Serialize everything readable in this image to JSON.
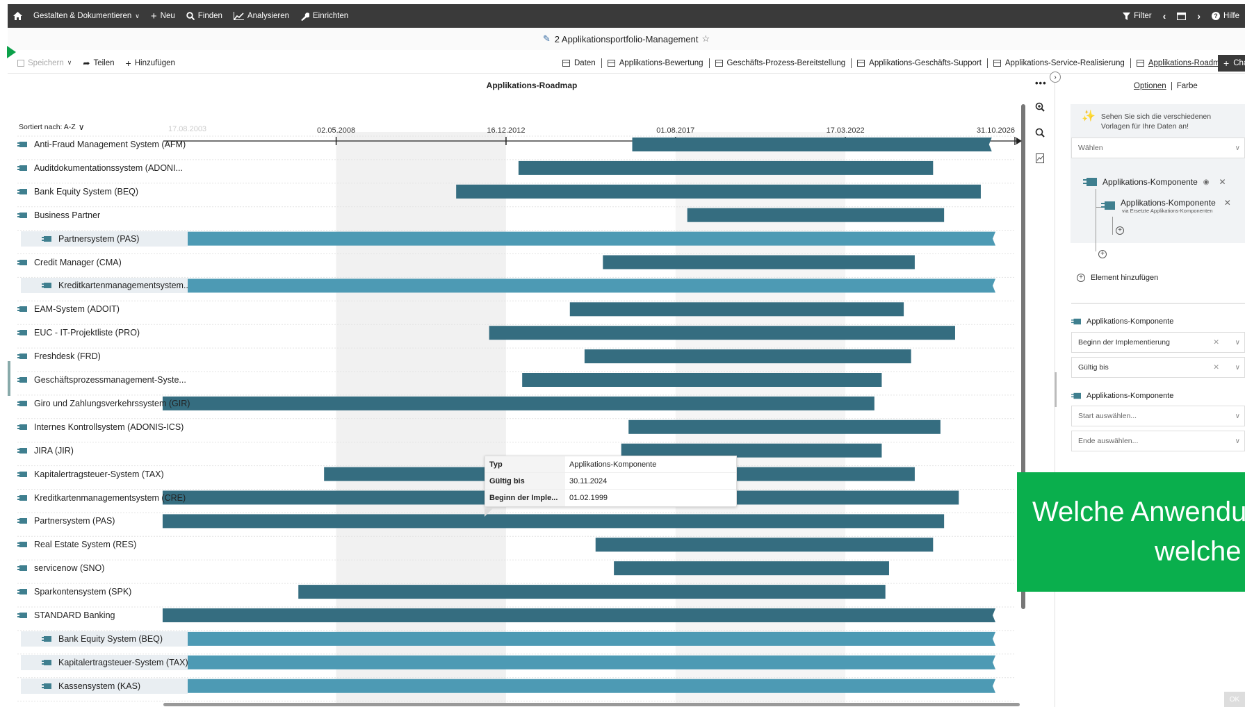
{
  "topnav": {
    "items": [
      {
        "label": "Gestalten & Dokumentieren",
        "icon": "chevron-down-icon"
      },
      {
        "label": "Neu",
        "icon": "plus-icon"
      },
      {
        "label": "Finden",
        "icon": "search-icon"
      },
      {
        "label": "Analysieren",
        "icon": "chart-line-icon"
      },
      {
        "label": "Einrichten",
        "icon": "wrench-icon"
      }
    ],
    "filter_label": "Filter",
    "help_label": "Hilfe"
  },
  "title": {
    "text": "2 Applikationsportfolio-Management",
    "star": "☆"
  },
  "toolbar": {
    "save_label": "Speichern",
    "share_label": "Teilen",
    "add_label": "Hinzufügen",
    "views": [
      {
        "label": "Daten",
        "icon": "table-icon",
        "active": false
      },
      {
        "label": "Applikations-Bewertung",
        "icon": "matrix-icon",
        "active": false
      },
      {
        "label": "Geschäfts-Prozess-Bereitstellung",
        "icon": "layout-icon",
        "active": false
      },
      {
        "label": "Applikations-Geschäfts-Support",
        "icon": "grid-icon",
        "active": false
      },
      {
        "label": "Applikations-Service-Realisierung",
        "icon": "grid-icon",
        "active": false
      },
      {
        "label": "Applikations-Roadmap",
        "icon": "roadmap-icon",
        "active": true
      }
    ],
    "chart_label": "Cha"
  },
  "chart": {
    "title": "Applikations-Roadmap",
    "more": "•••",
    "sort_label": "Sortiert nach: A-Z"
  },
  "chart_data": {
    "type": "gantt",
    "title": "Applikations-Roadmap",
    "axis": {
      "start_label_faded": "17.08.2003",
      "ticks": [
        "02.05.2008",
        "16.12.2012",
        "01.08.2017",
        "17.03.2022",
        "31.10.2026"
      ]
    },
    "rows": [
      {
        "label": "Anti-Fraud Management System (AFM)",
        "child": false,
        "start": 2016.4,
        "end": 2026.2
      },
      {
        "label": "Auditdokumentationssystem (ADONI...",
        "child": false,
        "start": 2013.3,
        "end": 2024.6
      },
      {
        "label": "Bank Equity System (BEQ)",
        "child": false,
        "start": 2011.6,
        "end": 2025.9
      },
      {
        "label": "Business Partner",
        "child": false,
        "start": 2017.9,
        "end": 2024.9
      },
      {
        "label": "Partnersystem (PAS)",
        "child": true,
        "start": 2003.6,
        "end": 2026.3
      },
      {
        "label": "Credit Manager (CMA)",
        "child": false,
        "start": 2015.6,
        "end": 2024.1
      },
      {
        "label": "Kreditkartenmanagementsystem...",
        "child": true,
        "start": 2003.6,
        "end": 2026.3
      },
      {
        "label": "EAM-System (ADOIT)",
        "child": false,
        "start": 2014.7,
        "end": 2023.8
      },
      {
        "label": "EUC - IT-Projektliste (PRO)",
        "child": false,
        "start": 2012.5,
        "end": 2025.2
      },
      {
        "label": "Freshdesk (FRD)",
        "child": false,
        "start": 2015.1,
        "end": 2024.0
      },
      {
        "label": "Geschäftsprozessmanagement-Syste...",
        "child": false,
        "start": 2013.4,
        "end": 2023.2
      },
      {
        "label": "Giro und Zahlungsverkehrssystem (GIR)",
        "child": false,
        "start": 2003.6,
        "end": 2023.0
      },
      {
        "label": "Internes Kontrollsystem (ADONIS-ICS)",
        "child": false,
        "start": 2016.3,
        "end": 2024.8
      },
      {
        "label": "JIRA (JIR)",
        "child": false,
        "start": 2016.1,
        "end": 2023.2
      },
      {
        "label": "Kapitalertragsteuer-System (TAX)",
        "child": false,
        "start": 2008.0,
        "end": 2024.1
      },
      {
        "label": "Kreditkartenmanagementsystem (CRE)",
        "child": false,
        "start": 2003.6,
        "end": 2025.3
      },
      {
        "label": "Partnersystem (PAS)",
        "child": false,
        "start": 2003.6,
        "end": 2024.9
      },
      {
        "label": "Real Estate System (RES)",
        "child": false,
        "start": 2015.4,
        "end": 2024.6
      },
      {
        "label": "servicenow (SNO)",
        "child": false,
        "start": 2015.9,
        "end": 2023.4
      },
      {
        "label": "Sparkontensystem (SPK)",
        "child": false,
        "start": 2007.3,
        "end": 2023.3
      },
      {
        "label": "STANDARD Banking",
        "child": false,
        "start": 2003.6,
        "end": 2026.3
      },
      {
        "label": "Bank Equity System (BEQ)",
        "child": true,
        "start": 2003.6,
        "end": 2026.3
      },
      {
        "label": "Kapitalertragsteuer-System (TAX)",
        "child": true,
        "start": 2003.6,
        "end": 2026.3
      },
      {
        "label": "Kassensystem (KAS)",
        "child": true,
        "start": 2003.6,
        "end": 2026.3
      }
    ]
  },
  "tooltip": {
    "rows": [
      {
        "key": "Typ",
        "value": "Applikations-Komponente"
      },
      {
        "key": "Gültig bis",
        "value": "30.11.2024"
      },
      {
        "key": "Beginn der Imple...",
        "value": "01.02.1999"
      }
    ]
  },
  "panel": {
    "tab_options": "Optionen",
    "tab_color": "Farbe",
    "hint": "Sehen Sie sich die verschiedenen Vorlagen für Ihre Daten an!",
    "template_select": "Wählen",
    "component_label": "Applikations-Komponente",
    "sub_component_label": "Applikations-Komponente",
    "sub_component_note": "via Ersetzte Applikations-Komponenten",
    "add_element": "Element hinzufügen",
    "section1_label": "Applikations-Komponente",
    "field_start": "Beginn der Implementierung",
    "field_end": "Gültig bis",
    "section2_label": "Applikations-Komponente",
    "select_start": "Start auswählen...",
    "select_end": "Ende auswählen..."
  },
  "banner": {
    "line1": "Welche Anwendu",
    "line2": "welche"
  },
  "ok_label": "OK"
}
